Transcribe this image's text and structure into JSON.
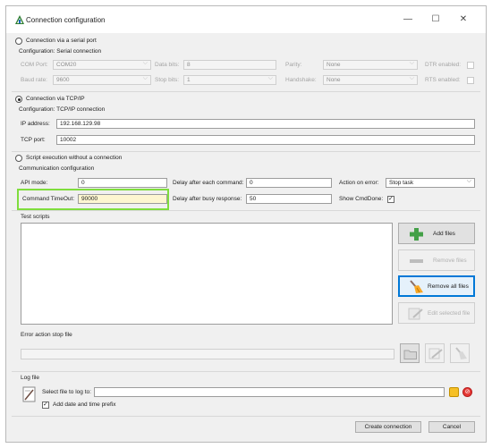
{
  "window": {
    "title": "Connection configuration",
    "minimize": "—",
    "maximize": "☐",
    "close": "✕"
  },
  "serial": {
    "radio_label": "Connection via a serial port",
    "config_label": "Configuration: Serial connection",
    "com_port_label": "COM Port:",
    "com_port_value": "COM20",
    "data_bits_label": "Data bits:",
    "data_bits_value": "8",
    "parity_label": "Parity:",
    "parity_value": "None",
    "dtr_label": "DTR enabled:",
    "baud_rate_label": "Baud rate:",
    "baud_rate_value": "9600",
    "stop_bits_label": "Stop bits:",
    "stop_bits_value": "1",
    "handshake_label": "Handshake:",
    "handshake_value": "None",
    "rts_label": "RTS enabled:"
  },
  "tcp": {
    "radio_label": "Connection via TCP/IP",
    "config_label": "Configuration: TCP/IP connection",
    "ip_label": "IP address:",
    "ip_value": "192.168.129.98",
    "port_label": "TCP port:",
    "port_value": "10002"
  },
  "script": {
    "radio_label": "Script execution without a connection",
    "config_label": "Communication configuration",
    "api_mode_label": "API mode:",
    "api_mode_value": "0",
    "delay_cmd_label": "Delay after each command:",
    "delay_cmd_value": "0",
    "action_error_label": "Action on error:",
    "action_error_value": "Stop task",
    "timeout_label": "Command TimeOut:",
    "timeout_value": "90000",
    "delay_busy_label": "Delay after busy response:",
    "delay_busy_value": "50",
    "show_cmd_done_label": "Show CmdDone:"
  },
  "test_scripts": {
    "label": "Test scripts",
    "add_files": "Add files",
    "remove_files": "Remove files",
    "remove_all_files": "Remove all files",
    "edit_selected_file": "Edit selected file"
  },
  "error_stop": {
    "label": "Error action stop file"
  },
  "log": {
    "label": "Log file",
    "select_label": "Select file to log to:",
    "date_prefix_label": "Add date and time prefix"
  },
  "footer": {
    "create_connection": "Create connection",
    "cancel": "Cancel"
  },
  "colors": {
    "accent": "#0078d7",
    "highlight": "#7fdd3d",
    "timeout_field": "#fdf6d0"
  }
}
